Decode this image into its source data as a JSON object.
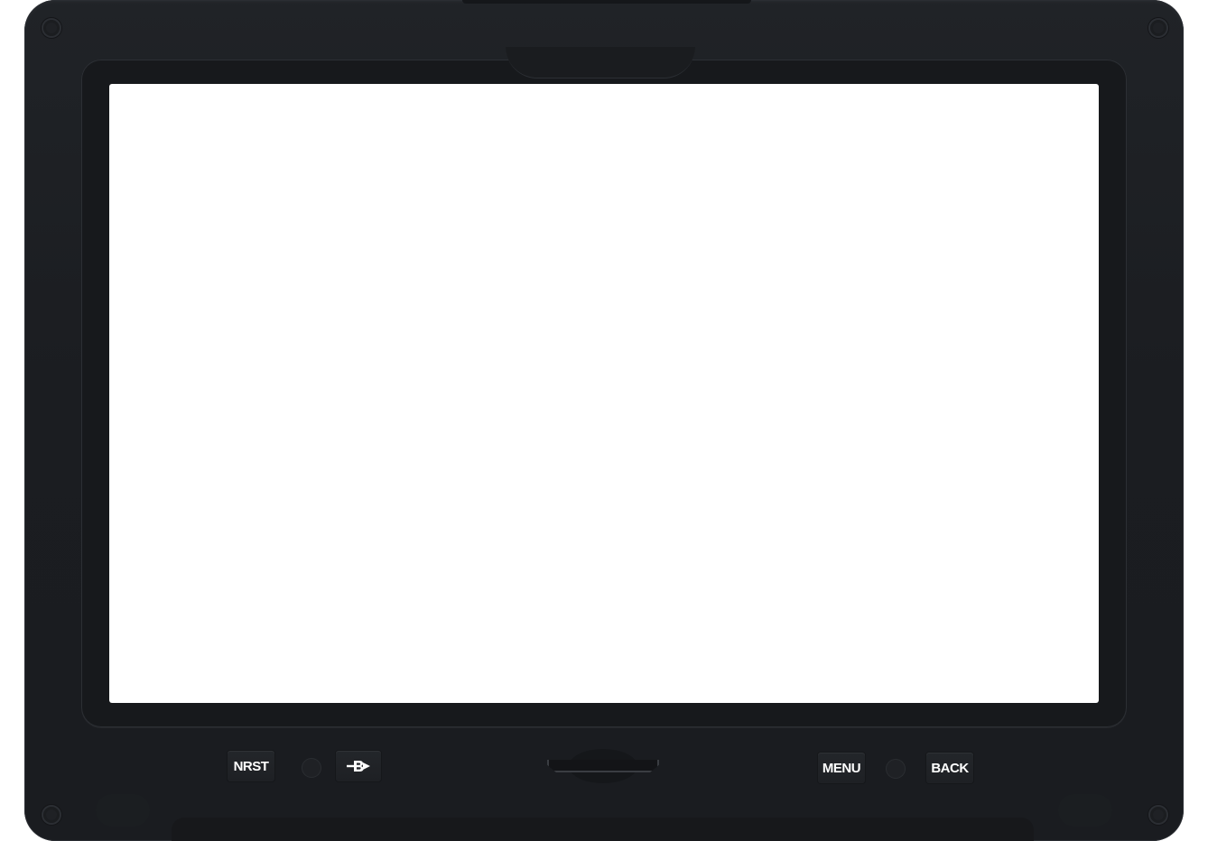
{
  "device": {
    "buttons": {
      "nrst": "NRST",
      "menu": "MENU",
      "back": "BACK",
      "direct_to_icon": "direct-to-icon"
    },
    "sd_card_slot": "sd-card-slot",
    "screen_color": "#ffffff",
    "bezel_color": "#1c1e22"
  }
}
